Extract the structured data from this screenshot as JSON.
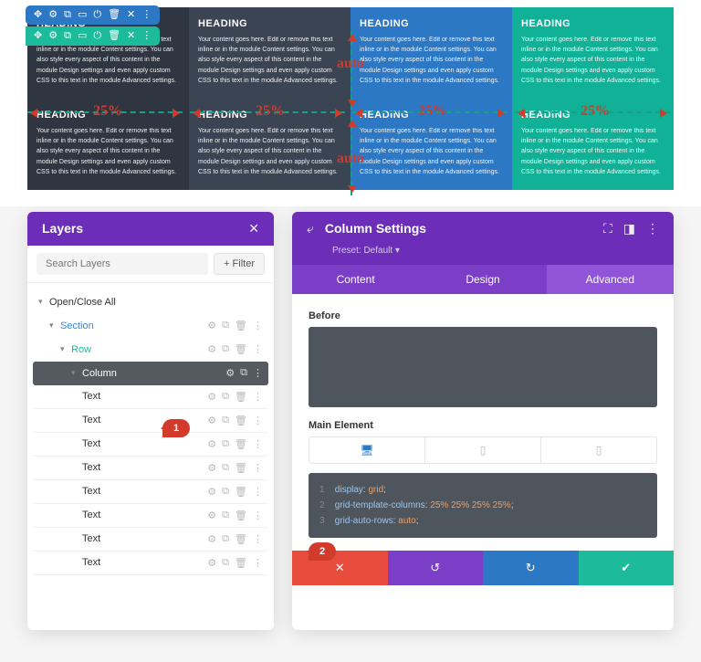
{
  "preview": {
    "cells": [
      {
        "heading": "HEADING",
        "body": "Your content goes here. Edit or remove this text inline or in the module Content settings. You can also style every aspect of this content in the module Design settings and even apply custom CSS to this text in the module Advanced settings.",
        "bg": "#2f3641"
      },
      {
        "heading": "HEADING",
        "body": "Your content goes here. Edit or remove this text inline or in the module Content settings. You can also style every aspect of this content in the module Design settings and even apply custom CSS to this text in the module Advanced settings.",
        "bg": "#3b4452"
      },
      {
        "heading": "HEADING",
        "body": "Your content goes here. Edit or remove this text inline or in the module Content settings. You can also style every aspect of this content in the module Design settings and even apply custom CSS to this text in the module Advanced settings.",
        "bg": "#2c78c4"
      },
      {
        "heading": "HEADING",
        "body": "Your content goes here. Edit or remove this text inline or in the module Content settings. You can also style every aspect of this content in the module Design settings and even apply custom CSS to this text in the module Advanced settings.",
        "bg": "#10b197"
      },
      {
        "heading": "HEADING",
        "body": "Your content goes here. Edit or remove this text inline or in the module Content settings. You can also style every aspect of this content in the module Design settings and even apply custom CSS to this text in the module Advanced settings.",
        "bg": "#2f3641"
      },
      {
        "heading": "HEADING",
        "body": "Your content goes here. Edit or remove this text inline or in the module Content settings. You can also style every aspect of this content in the module Design settings and even apply custom CSS to this text in the module Advanced settings.",
        "bg": "#3b4452"
      },
      {
        "heading": "HEADING",
        "body": "Your content goes here. Edit or remove this text inline or in the module Content settings. You can also style every aspect of this content in the module Design settings and even apply custom CSS to this text in the module Advanced settings.",
        "bg": "#2c78c4"
      },
      {
        "heading": "HEADING",
        "body": "Your content goes here. Edit or remove this text inline or in the module Content settings. You can also style every aspect of this content in the module Design settings and even apply custom CSS to this text in the module Advanced settings.",
        "bg": "#10b197"
      }
    ],
    "toolbar_icons": [
      "✥",
      "⚙",
      "⧉",
      "▭",
      "⏻",
      "🗑",
      "✕",
      "⋮"
    ],
    "width_label": "25%",
    "auto_label": "auto"
  },
  "layers": {
    "title": "Layers",
    "search_placeholder": "Search Layers",
    "filter_label": "+ Filter",
    "open_all": "Open/Close All",
    "section": "Section",
    "row": "Row",
    "column": "Column",
    "text": "Text",
    "text_count": 8
  },
  "settings": {
    "title": "Column Settings",
    "preset": "Preset: Default ▾",
    "tabs": {
      "content": "Content",
      "design": "Design",
      "advanced": "Advanced"
    },
    "before": "Before",
    "main_element": "Main Element",
    "devices": {
      "desktop": "🖥",
      "tablet": "▯",
      "phone": "▯"
    },
    "code": [
      {
        "n": "1",
        "k": "display",
        "v": "grid",
        "sep": ":",
        "end": ";"
      },
      {
        "n": "2",
        "k": "grid-template-columns",
        "v": "25% 25% 25% 25%",
        "sep": ":",
        "end": ";"
      },
      {
        "n": "3",
        "k": "grid-auto-rows",
        "v": "auto",
        "sep": ":",
        "end": ";"
      }
    ],
    "actions": {
      "cancel": "✕",
      "undo": "↺",
      "redo": "↻",
      "save": "✔"
    }
  },
  "markers": {
    "m1": "1",
    "m2": "2"
  }
}
